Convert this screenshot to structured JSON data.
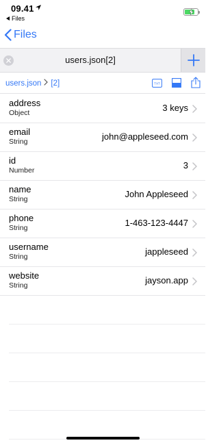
{
  "status_bar": {
    "time": "09.41",
    "back_app": "Files",
    "battery_level": 0.8
  },
  "nav": {
    "back_label": "Files"
  },
  "tab": {
    "title": "users.json[2]"
  },
  "breadcrumb": {
    "items": [
      "users.json",
      "[2]"
    ]
  },
  "toolbar": {
    "txt_icon_label": "TXT"
  },
  "rows": [
    {
      "key": "address",
      "type": "Object",
      "value": "3 keys"
    },
    {
      "key": "email",
      "type": "String",
      "value": "john@appleseed.com"
    },
    {
      "key": "id",
      "type": "Number",
      "value": "3"
    },
    {
      "key": "name",
      "type": "String",
      "value": "John Appleseed"
    },
    {
      "key": "phone",
      "type": "String",
      "value": "1-463-123-4447"
    },
    {
      "key": "username",
      "type": "String",
      "value": "jappleseed"
    },
    {
      "key": "website",
      "type": "String",
      "value": "jayson.app"
    }
  ],
  "colors": {
    "accent": "#3478f6",
    "battery": "#4cd964",
    "separator": "#e6e6e9"
  }
}
